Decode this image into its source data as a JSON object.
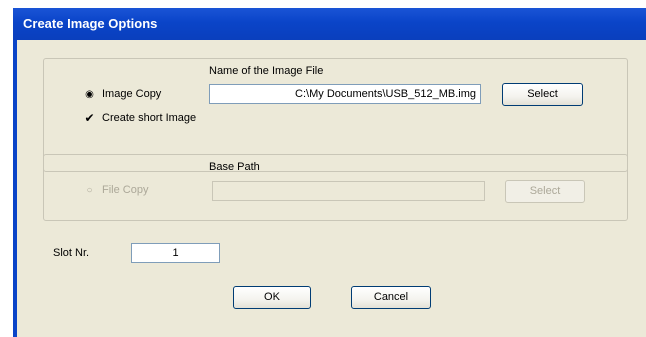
{
  "window": {
    "title": "Create Image Options"
  },
  "image_group": {
    "heading": "Name of the Image File",
    "radio_label": "Image Copy",
    "radio_selected": true,
    "checkbox_label": "Create short Image",
    "checkbox_checked": true,
    "file_value": "C:\\My Documents\\USB_512_MB.img",
    "select_label": "Select"
  },
  "file_group": {
    "heading": "Base Path",
    "radio_label": "File Copy",
    "radio_selected": false,
    "path_value": "",
    "select_label": "Select",
    "enabled": false
  },
  "slot": {
    "label": "Slot Nr.",
    "value": "1"
  },
  "buttons": {
    "ok": "OK",
    "cancel": "Cancel"
  },
  "icons": {
    "radio_on": "radio-selected-icon",
    "radio_off": "radio-unselected-icon",
    "check": "checkmark-icon"
  },
  "colors": {
    "titlebar": "#0a44c8",
    "dialog_bg": "#ece9d8",
    "disabled_text": "#aca899"
  }
}
